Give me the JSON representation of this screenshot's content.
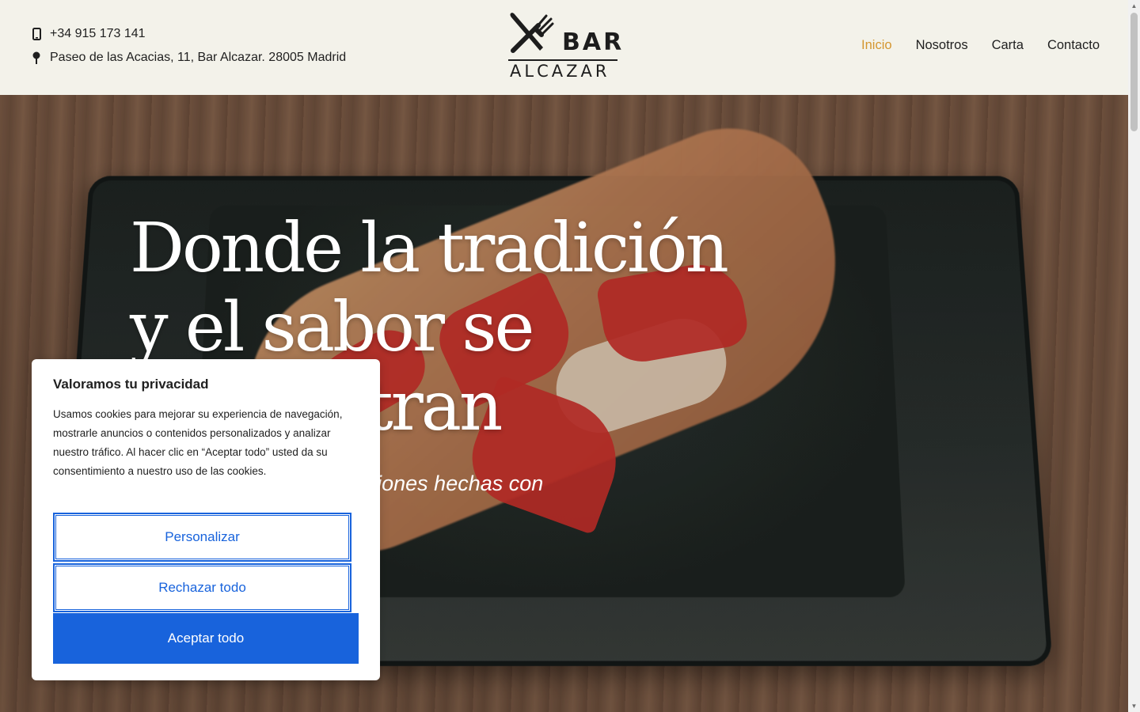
{
  "header": {
    "phone": "+34 915 173 141",
    "address": "Paseo de las Acacias, 11, Bar Alcazar. 28005 Madrid",
    "logo": {
      "line1": "BAR",
      "line2": "ALCAZAR"
    },
    "nav": [
      {
        "label": "Inicio",
        "active": true
      },
      {
        "label": "Nosotros",
        "active": false
      },
      {
        "label": "Carta",
        "active": false
      },
      {
        "label": "Contacto",
        "active": false
      }
    ]
  },
  "hero": {
    "title": "Donde la tradición y el sabor se encuentran",
    "subtitle": "Disfruta de las tapas y raciones hechas con corazón."
  },
  "cookie": {
    "title": "Valoramos tu privacidad",
    "text": "Usamos cookies para mejorar su experiencia de navegación, mostrarle anuncios o contenidos personalizados y analizar nuestro tráfico. Al hacer clic en “Aceptar todo” usted da su consentimiento a nuestro uso de las cookies.",
    "customize_label": "Personalizar",
    "reject_label": "Rechazar todo",
    "accept_label": "Aceptar todo"
  },
  "colors": {
    "nav_active": "#d4962f",
    "header_bg": "#f3f2ea",
    "cookie_primary": "#1863dc"
  },
  "icons": {
    "phone": "mobile-phone-icon",
    "address": "location-pin-icon",
    "logo": "fork-knife-icon"
  }
}
